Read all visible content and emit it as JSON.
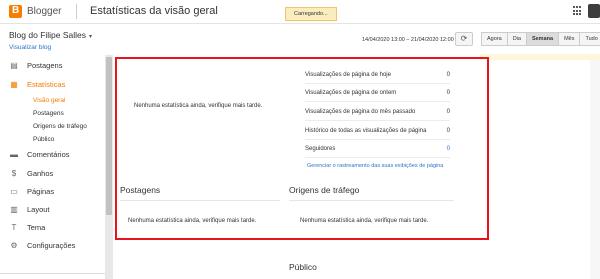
{
  "header": {
    "brand": "Blogger",
    "title": "Estatísticas da visão geral",
    "loading": "Carregando..."
  },
  "blog": {
    "name": "Blog do Filipe Salles",
    "caret": "▾",
    "view_link": "Visualizar blog"
  },
  "toolbar": {
    "date_range": "14/04/2020 13:00 – 21/04/2020 12:00",
    "refresh_icon": "⟳",
    "ranges": [
      "Agora",
      "Dia",
      "Semana",
      "Mês",
      "Tudo"
    ],
    "active_range": "Semana"
  },
  "sidebar": {
    "items": [
      {
        "label": "Postagens",
        "icon": "▤",
        "icon_name": "postagens-icon"
      },
      {
        "label": "Estatísticas",
        "icon": "▦",
        "icon_name": "stats-icon"
      },
      {
        "label": "Comentários",
        "icon": "▬",
        "icon_name": "comment-icon"
      },
      {
        "label": "Ganhos",
        "icon": "$",
        "icon_name": "dollar-icon"
      },
      {
        "label": "Páginas",
        "icon": "▭",
        "icon_name": "pages-icon"
      },
      {
        "label": "Layout",
        "icon": "▥",
        "icon_name": "layout-icon"
      },
      {
        "label": "Tema",
        "icon": "T",
        "icon_name": "theme-icon"
      },
      {
        "label": "Configurações",
        "icon": "⚙",
        "icon_name": "gear-icon"
      }
    ],
    "sub_items": [
      "Visão geral",
      "Postagens",
      "Origens de tráfego",
      "Público"
    ]
  },
  "overview": {
    "empty_message": "Nenhuma estatística ainda, verifique mais tarde.",
    "stats": [
      {
        "label": "Visualizações de página de hoje",
        "value": "0"
      },
      {
        "label": "Visualizações de página de ontem",
        "value": "0"
      },
      {
        "label": "Visualizações de página do mês passado",
        "value": "0"
      },
      {
        "label": "Histórico de todas as visualizações de página",
        "value": "0"
      },
      {
        "label": "Seguidores",
        "value": "0"
      }
    ],
    "manage_link": "Gerenciar o rastreamento das suas exibições de página"
  },
  "posts": {
    "title": "Postagens",
    "empty_message": "Nenhuma estatística ainda, verifique mais tarde."
  },
  "traffic": {
    "title": "Origens de tráfego",
    "empty_message": "Nenhuma estatística ainda, verifique mais tarde."
  },
  "audience": {
    "title": "Público"
  },
  "colors": {
    "brand": "#f57d00",
    "highlight": "#e8141b",
    "link": "#2a77c9"
  }
}
